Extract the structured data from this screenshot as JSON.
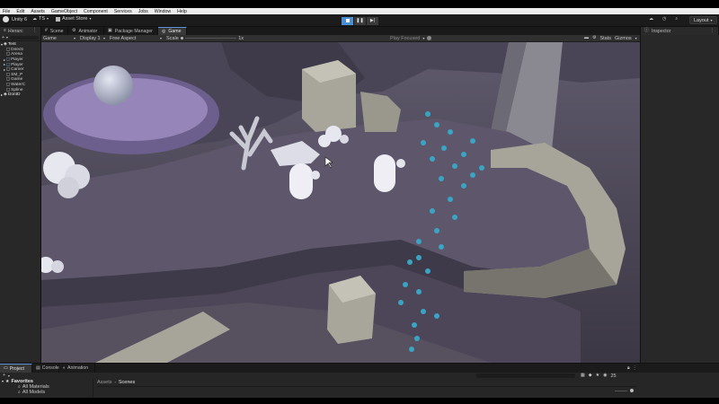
{
  "menu": [
    "File",
    "Edit",
    "Assets",
    "GameObject",
    "Component",
    "Services",
    "Jobs",
    "Window",
    "Help"
  ],
  "toolbar": {
    "app_label": "Unity 6",
    "account_label": "TS",
    "asset_store_label": "Asset Store",
    "layout_label": "Layout"
  },
  "tabs": [
    {
      "label": "Scene",
      "icon": "grid-icon"
    },
    {
      "label": "Animator",
      "icon": "animator-icon"
    },
    {
      "label": "Package Manager",
      "icon": "package-icon"
    },
    {
      "label": "Game",
      "icon": "gamepad-icon",
      "active": true
    }
  ],
  "hierarchy": {
    "title": "Hierarc",
    "scene": "Test",
    "items": [
      "Directi",
      "Arena",
      "Player",
      "Player",
      "Camer",
      "SM_P",
      "Game",
      "WaterC",
      "Spline"
    ],
    "dontdestroy": "DontD"
  },
  "game_header": {
    "mode": "Game",
    "display": "Display 1",
    "aspect": "Free Aspect",
    "scale_label": "Scale",
    "scale_value": "1x",
    "play_focused": "Play Focused",
    "stats": "Stats",
    "gizmos": "Gizmos"
  },
  "inspector": {
    "title": "Inspector"
  },
  "bottom_tabs": [
    {
      "label": "Project",
      "active": true
    },
    {
      "label": "Console"
    },
    {
      "label": "Animation"
    }
  ],
  "project": {
    "favorites_label": "Favorites",
    "favorites": [
      "All Materials",
      "All Models"
    ],
    "breadcrumb": [
      "Assets",
      "Scenes"
    ],
    "badge_count": "25"
  },
  "colors": {
    "accent": "#4a8fd6",
    "scene_floor": "#5e566b",
    "particles": "#3aa4c4"
  }
}
